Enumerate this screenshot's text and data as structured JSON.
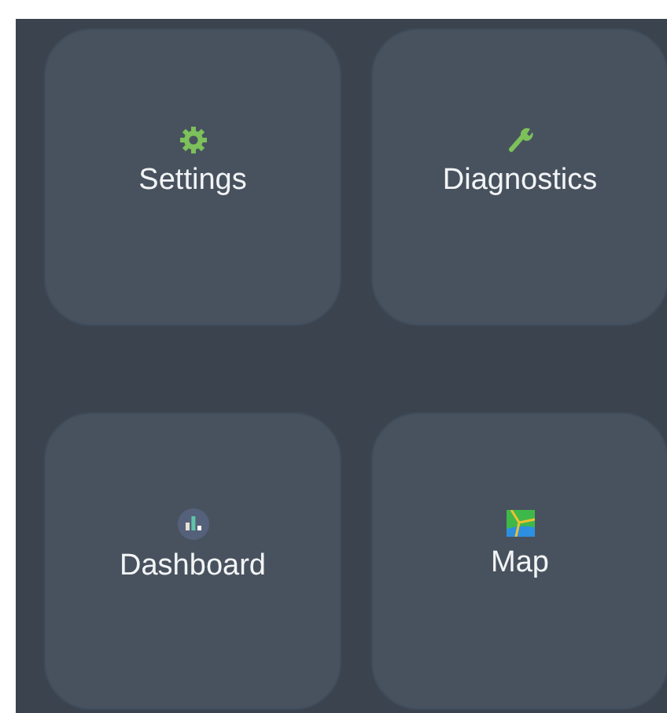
{
  "tiles": [
    {
      "label": "Settings",
      "kind": "gear"
    },
    {
      "label": "Diagnostics",
      "kind": "wrench"
    },
    {
      "label": "Dashboard",
      "kind": "chart"
    },
    {
      "label": "Map",
      "kind": "map"
    }
  ]
}
